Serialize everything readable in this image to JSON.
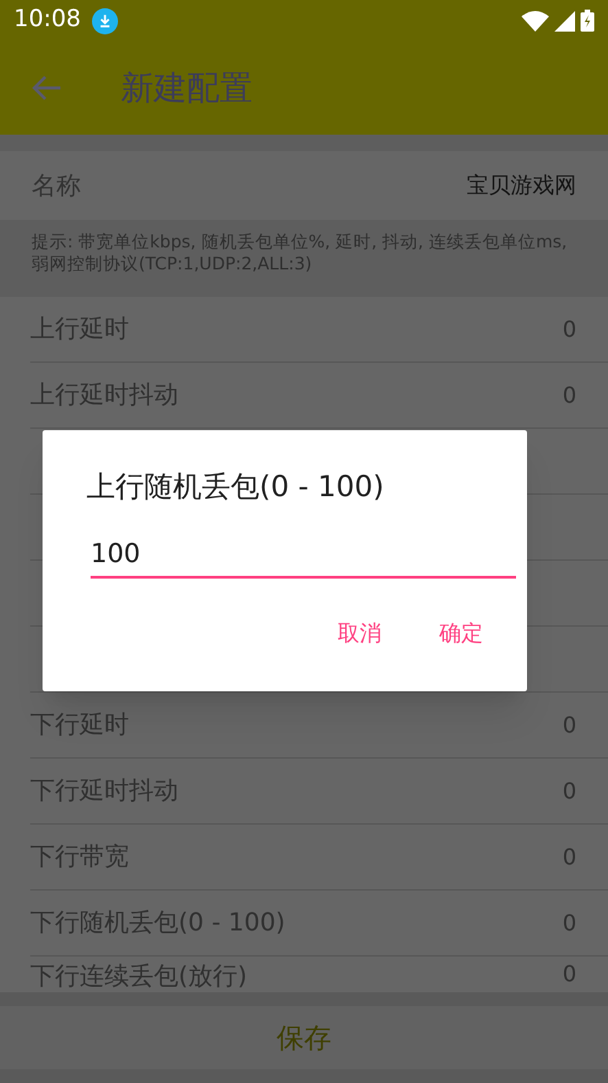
{
  "status_bar": {
    "time": "10:08"
  },
  "app_bar": {
    "title": "新建配置"
  },
  "name_field": {
    "label": "名称",
    "value": "宝贝游戏网"
  },
  "hint": "提示: 带宽单位kbps, 随机丢包单位%, 延时, 抖动, 连续丢包单位ms, 弱网控制协议(TCP:1,UDP:2,ALL:3)",
  "rows": [
    {
      "kind": "setting",
      "label": "上行延时",
      "value": "0"
    },
    {
      "kind": "setting",
      "label": "上行延时抖动",
      "value": "0"
    },
    {
      "kind": "covered"
    },
    {
      "kind": "covered"
    },
    {
      "kind": "covered"
    },
    {
      "kind": "covered"
    },
    {
      "kind": "setting",
      "label": "下行延时",
      "value": "0"
    },
    {
      "kind": "setting",
      "label": "下行延时抖动",
      "value": "0"
    },
    {
      "kind": "setting",
      "label": "下行带宽",
      "value": "0"
    },
    {
      "kind": "setting",
      "label": "下行随机丢包(0 - 100)",
      "value": "0"
    },
    {
      "kind": "setting",
      "label": "下行连续丢包(放行)",
      "value": "0"
    }
  ],
  "save_button": "保存",
  "dialog": {
    "title": "上行随机丢包(0 - 100)",
    "value": "100",
    "buttons": [
      "取消",
      "确定"
    ]
  }
}
